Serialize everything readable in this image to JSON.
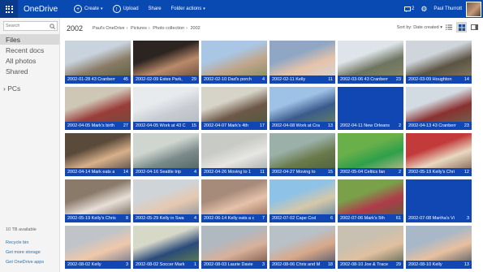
{
  "app": {
    "brand": "OneDrive",
    "commands": [
      {
        "label": "Create",
        "icon": "plus-icon",
        "caret": true
      },
      {
        "label": "Upload",
        "icon": "upload-icon",
        "caret": false
      },
      {
        "label": "Share",
        "icon": "",
        "caret": false
      },
      {
        "label": "Folder actions",
        "icon": "",
        "caret": true
      }
    ],
    "notifications_count": "2",
    "user_name": "Paul Thurrott",
    "accent": "#094ab2"
  },
  "sidebar": {
    "search_placeholder": "Search",
    "nav": [
      {
        "label": "Files",
        "active": true
      },
      {
        "label": "Recent docs",
        "active": false
      },
      {
        "label": "All photos",
        "active": false
      },
      {
        "label": "Shared",
        "active": false
      }
    ],
    "pcs_label": "PCs",
    "storage": "10 TB available",
    "links": [
      "Recycle bin",
      "Get more storage",
      "Get OneDrive apps"
    ]
  },
  "main": {
    "folder_title": "2002",
    "breadcrumb": [
      "Paul's OneDrive",
      "Pictures",
      "Photo collection",
      "2002"
    ],
    "sort_label": "Sort by: Date created",
    "tiles": [
      {
        "name": "2002-01-28 43 Cranberr",
        "count": "45",
        "colors": [
          "#c9d3de",
          "#8a7b66",
          "#4f5a3a"
        ]
      },
      {
        "name": "2002-02-09 Estes Park,",
        "count": "29",
        "colors": [
          "#2c2420",
          "#b98a6a",
          "#5a4032"
        ]
      },
      {
        "name": "2002-02-10 Dad's porch",
        "count": "4",
        "colors": [
          "#a9c6e4",
          "#c0a58a",
          "#7a8a5a"
        ]
      },
      {
        "name": "2002-02-11 Kelly",
        "count": "11",
        "colors": [
          "#8fa7c4",
          "#e6c3aa",
          "#d0d8e6"
        ]
      },
      {
        "name": "2002-03-06 43 Cranberr",
        "count": "23",
        "colors": [
          "#dfe4ea",
          "#6d7460",
          "#8c8a6c"
        ]
      },
      {
        "name": "2002-03-09 Houghton",
        "count": "14",
        "colors": [
          "#cfd5da",
          "#5c5444",
          "#8a8266"
        ]
      },
      {
        "name": "2002-04-05 Mark's birth",
        "count": "27",
        "colors": [
          "#cfc7b6",
          "#9a3d3a",
          "#6a4e3a"
        ]
      },
      {
        "name": "2002-04-05 Work at 43 C",
        "count": "15",
        "colors": [
          "#e8ebee",
          "#c8ccd2",
          "#b1b6bc"
        ]
      },
      {
        "name": "2002-04-07 Mark's 4th",
        "count": "17",
        "colors": [
          "#d6d4c8",
          "#6d5848",
          "#4a5c3a"
        ]
      },
      {
        "name": "2002-04-08 Work at Cra",
        "count": "13",
        "colors": [
          "#9ec1e6",
          "#3a5a8c",
          "#6a8a5a"
        ]
      },
      {
        "name": "2002-04-11 New Orleans",
        "count": "2",
        "colors": []
      },
      {
        "name": "2002-04-13 43 Cranberr",
        "count": "23",
        "colors": [
          "#d2dbe2",
          "#8a3030",
          "#6a7258"
        ]
      },
      {
        "name": "2002-04-14 Mark eats a",
        "count": "14",
        "colors": [
          "#5a4a3a",
          "#d8b08a",
          "#3a3a3a"
        ]
      },
      {
        "name": "2002-04-16 Seattle trip",
        "count": "4",
        "colors": [
          "#cfd6d0",
          "#7a8a8a",
          "#4a5a5a"
        ]
      },
      {
        "name": "2002-04-26 Moving to 1",
        "count": "11",
        "colors": [
          "#c8cac6",
          "#e6e6e2",
          "#9aa0a0"
        ]
      },
      {
        "name": "2002-04-27 Moving to",
        "count": "15",
        "colors": [
          "#9ab0a8",
          "#6a7a4a",
          "#4a5a3a"
        ]
      },
      {
        "name": "2002-05-04 Celtics fan",
        "count": "2",
        "colors": [
          "#6ab04a",
          "#2ea04a",
          "#d8c0a0"
        ]
      },
      {
        "name": "2002-05-19 Kelly's Chri",
        "count": "12",
        "colors": [
          "#c23a3a",
          "#e8d8c0",
          "#6a4a3a"
        ]
      },
      {
        "name": "2002-05-19 Kelly's Chris",
        "count": "8",
        "colors": [
          "#8a7a6a",
          "#e8e0d8",
          "#5a4a3a"
        ]
      },
      {
        "name": "2002-05-29 Kelly in Swa",
        "count": "4",
        "colors": [
          "#cfd4d8",
          "#e6c8b0",
          "#7a8a9a"
        ]
      },
      {
        "name": "2002-06-14 Kelly eats a c",
        "count": "7",
        "colors": [
          "#a68a7a",
          "#e6c2aa",
          "#8a5a4a"
        ]
      },
      {
        "name": "2002-07-02 Cape Cod",
        "count": "6",
        "colors": [
          "#8ec2e6",
          "#d6c8a8",
          "#4a7aa6"
        ]
      },
      {
        "name": "2002-07-06 Mark's 5th",
        "count": "61",
        "colors": [
          "#7aa04a",
          "#b03a4a",
          "#4a6a3a"
        ]
      },
      {
        "name": "2002-07-08 Martha's Vi",
        "count": "3",
        "colors": []
      },
      {
        "name": "2002-08-02 Kelly",
        "count": "3",
        "colors": [
          "#c0c4c8",
          "#f0c8aa",
          "#5a6a8a"
        ]
      },
      {
        "name": "2002-08-02 Soccer Mark",
        "count": "1",
        "colors": [
          "#d6d8c8",
          "#2a4a7a",
          "#6a8a4a"
        ]
      },
      {
        "name": "2002-08-03 Laurie Davie",
        "count": "3",
        "colors": [
          "#b0b8c0",
          "#d8b09a",
          "#6a4a3a"
        ]
      },
      {
        "name": "2002-08-06 Chris and M",
        "count": "18",
        "colors": [
          "#b8c0c8",
          "#d8a888",
          "#3a4a6a"
        ]
      },
      {
        "name": "2002-08-10 Joe & Trace",
        "count": "29",
        "colors": [
          "#c8c0b0",
          "#e0c0a0",
          "#4a5a4a"
        ]
      },
      {
        "name": "2002-08-10 Kelly",
        "count": "13",
        "colors": [
          "#a8b8c8",
          "#e8c0a0",
          "#3a4a5a"
        ]
      }
    ]
  }
}
